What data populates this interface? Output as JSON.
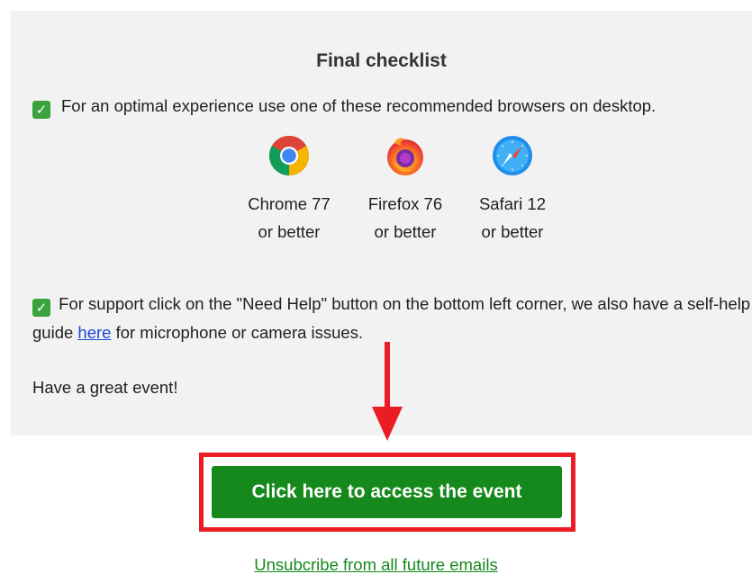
{
  "checklist": {
    "title": "Final checklist",
    "check_glyph": "✓",
    "browser_line": "For an optimal experience use one of these recommended browsers on desktop.",
    "browsers": [
      {
        "name": "Chrome 77",
        "sub": "or better",
        "icon": "chrome-icon"
      },
      {
        "name": "Firefox 76",
        "sub": "or better",
        "icon": "firefox-icon"
      },
      {
        "name": "Safari 12",
        "sub": "or better",
        "icon": "safari-icon"
      }
    ],
    "support_before": "For support click on the \"Need Help\" button on the bottom left corner, we also have a self-help guide ",
    "support_link": "here",
    "support_after": " for microphone or camera issues.",
    "greeting": "Have a great event!"
  },
  "cta": {
    "label": "Click here to access the event",
    "color": "#15891b",
    "highlight_color": "#ec1c24"
  },
  "footer": {
    "unsubscribe": "Unsubcribe from all future emails"
  }
}
